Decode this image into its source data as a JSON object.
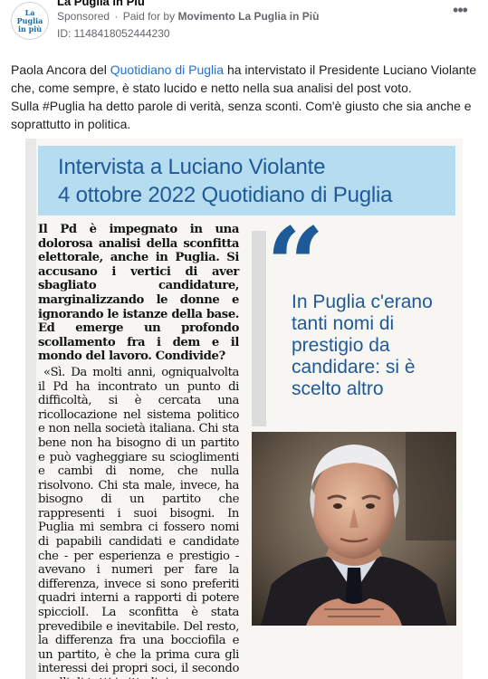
{
  "post": {
    "page_name": "La Puglia in Più",
    "logo_text": "La Puglia in più",
    "sponsored_label": "Sponsored",
    "paid_for_prefix": "Paid for by",
    "paid_for_by": "Movimento La Puglia in Più",
    "ad_id": "ID: 1148418052444230",
    "more_label": "•••"
  },
  "caption": {
    "part1": "Paola Ancora del ",
    "link": "Quotidiano di Puglia",
    "part2": " ha intervistato il Presidente Luciano Violante che, come sempre, è stato lucido e netto nella sua analisi del post voto.",
    "part3": "Sulla #Puglia ha detto parole di verità, senza sconti. Com'è giusto che sia anche e soprattutto in politica."
  },
  "article": {
    "title_line1": "Intervista a Luciano Violante",
    "title_line2": "4 ottobre 2022 Quotidiano di Puglia",
    "question": "Il Pd è impegnato in una dolorosa analisi della sconfitta elettorale, anche in Puglia. Si accusano i vertici di aver sbagliato candidature, marginalizzando le donne e ignorando le istanze della base. Ed emerge un profondo scollamento fra i dem e il mondo del lavoro. Condivide?",
    "answer": "«Sì. Da molti anni, ogniqualvolta il Pd ha incontrato un punto di difficoltà, si è cercata una ricollocazione nel sistema politico e non nella società italiana. Chi sta bene non ha bisogno di un partito e può vagheggiare su scioglimenti e cambi di nome, che nulla risolvono. Chi sta male, invece, ha bisogno di un partito che rappresenti i suoi bisogni. In Puglia mi sembra ci fossero nomi di papabili candidati e candidate che - per esperienza e prestigio - avevano i numeri per fare la differenza, invece si sono preferiti quadri interni a rapporti di potere spicciolI. La sconfitta è stata prevedibile e inevitabile. Del resto, la differenza fra una bocciofila e un partito, è che la prima cura gli interessi dei propri soci, il secondo quelli di tutti i cittadini».",
    "quote_mark": "“",
    "pull_quote": "In Puglia c'erano tanti nomi di prestigio da candidare: si è scelto altro"
  },
  "colors": {
    "banner_bg": "#b6dcef",
    "brand_blue": "#1f5a98",
    "link_blue": "#216fdb"
  }
}
